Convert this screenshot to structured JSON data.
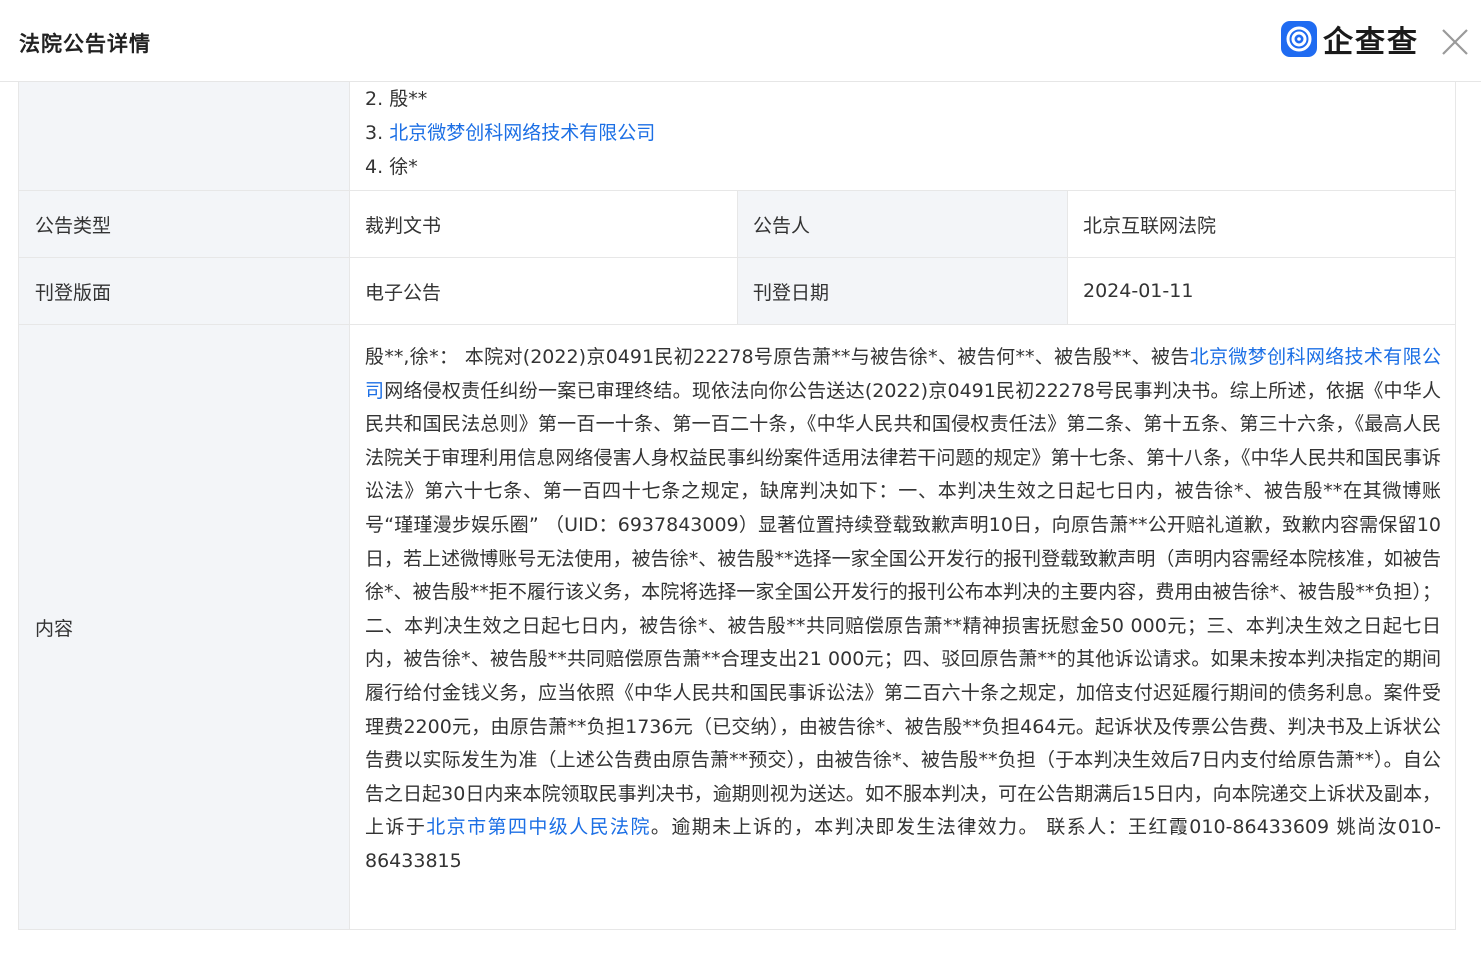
{
  "header": {
    "title": "法院公告详情",
    "brand": "企查查",
    "brand_color": "#1f6bf1",
    "close_icon": "close-icon"
  },
  "parties": [
    {
      "num": "2.",
      "name": "殷**",
      "link": false
    },
    {
      "num": "3.",
      "name": "北京微梦创科网络技术有限公司",
      "link": true
    },
    {
      "num": "4.",
      "name": "徐*",
      "link": false
    }
  ],
  "rows": {
    "type_label": "公告类型",
    "type_value": "裁判文书",
    "announcer_label": "公告人",
    "announcer_value": "北京互联网法院",
    "page_label": "刊登版面",
    "page_value": "电子公告",
    "date_label": "刊登日期",
    "date_value": "2024-01-11",
    "content_label": "内容"
  },
  "content": {
    "p1": "殷**,徐*： 本院对(2022)京0491民初22278号原告萧**与被告徐*、被告何**、被告殷**、被告",
    "link1": "北京微梦创科网络技术有限公司",
    "p2": "网络侵权责任纠纷一案已审理终结。现依法向你公告送达(2022)京0491民初22278号民事判决书。综上所述，依据《中华人民共和国民法总则》第一百一十条、第一百二十条，《中华人民共和国侵权责任法》第二条、第十五条、第三十六条，《最高人民法院关于审理利用信息网络侵害人身权益民事纠纷案件适用法律若干问题的规定》第十七条、第十八条，《中华人民共和国民事诉讼法》第六十七条、第一百四十七条之规定，缺席判决如下：一、本判决生效之日起七日内，被告徐*、被告殷**在其微博账号“瑾瑾漫步娱乐圈” （UID：6937843009）显著位置持续登载致歉声明10日，向原告萧**公开赔礼道歉，致歉内容需保留10日，若上述微博账号无法使用，被告徐*、被告殷**选择一家全国公开发行的报刊登载致歉声明（声明内容需经本院核准，如被告徐*、被告殷**拒不履行该义务，本院将选择一家全国公开发行的报刊公布本判决的主要内容，费用由被告徐*、被告殷**负担）；二、本判决生效之日起七日内，被告徐*、被告殷**共同赔偿原告萧**精神损害抚慰金50 000元；三、本判决生效之日起七日内，被告徐*、被告殷**共同赔偿原告萧**合理支出21 000元；四、驳回原告萧**的其他诉讼请求。如果未按本判决指定的期间履行给付金钱义务，应当依照《中华人民共和国民事诉讼法》第二百六十条之规定，加倍支付迟延履行期间的债务利息。案件受理费2200元，由原告萧**负担1736元（已交纳），由被告徐*、被告殷**负担464元。起诉状及传票公告费、判决书及上诉状公告费以实际发生为准（上述公告费由原告萧**预交），由被告徐*、被告殷**负担（于本判决生效后7日内支付给原告萧**）。自公告之日起30日内来本院领取民事判决书，逾期则视为送达。如不服本判决，可在公告期满后15日内，向本院递交上诉状及副本，上诉于",
    "link2": "北京市第四中级人民法院",
    "p3": "。逾期未上诉的，本判决即发生法律效力。 联系人：王红霞010-86433609 姚尚汝010-86433815"
  },
  "colors": {
    "link": "#1c6fe5",
    "label_bg": "#f3f5f8",
    "border": "#e7e7e7"
  }
}
